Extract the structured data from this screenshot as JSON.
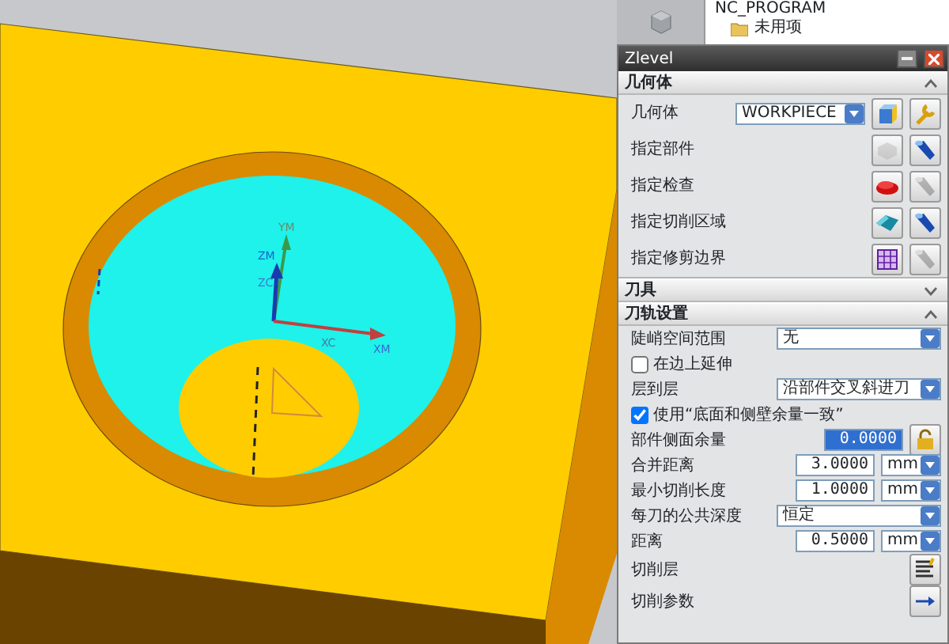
{
  "viewport": {
    "axis_labels": [
      "YM",
      "ZM",
      "ZC",
      "XC",
      "XM"
    ]
  },
  "navigator": {
    "items": [
      {
        "label": "NC_PROGRAM"
      },
      {
        "label": "未用项"
      }
    ]
  },
  "dialog": {
    "title": "Zlevel",
    "sections": [
      {
        "title": "几何体",
        "expanded": true,
        "rows": [
          {
            "kind": "select",
            "label": "几何体",
            "value": "WORKPIECE",
            "buttons": [
              {
                "kind": "new",
                "disabled": false
              },
              {
                "kind": "edit",
                "disabled": false
              }
            ]
          },
          {
            "kind": "specify",
            "label": "指定部件",
            "buttons": [
              {
                "kind": "part",
                "disabled": true
              },
              {
                "kind": "display",
                "disabled": false
              }
            ]
          },
          {
            "kind": "specify",
            "label": "指定检查",
            "buttons": [
              {
                "kind": "check",
                "disabled": false
              },
              {
                "kind": "display",
                "disabled": true
              }
            ]
          },
          {
            "kind": "specify",
            "label": "指定切削区域",
            "buttons": [
              {
                "kind": "area",
                "disabled": false
              },
              {
                "kind": "display",
                "disabled": false
              }
            ]
          },
          {
            "kind": "specify",
            "label": "指定修剪边界",
            "buttons": [
              {
                "kind": "trim",
                "disabled": false
              },
              {
                "kind": "display",
                "disabled": true
              }
            ]
          }
        ]
      },
      {
        "title": "刀具",
        "expanded": false
      },
      {
        "title": "刀轨设置",
        "expanded": true,
        "rows": [
          {
            "kind": "select",
            "label": "陡峭空间范围",
            "value": "无"
          },
          {
            "kind": "checkbox",
            "label": "在边上延伸",
            "checked": false
          },
          {
            "kind": "select",
            "label": "层到层",
            "value": "沿部件交叉斜进刀"
          },
          {
            "kind": "checkbox",
            "label": "使用“底面和侧壁余量一致”",
            "checked": true
          },
          {
            "kind": "number",
            "label": "部件侧面余量",
            "value": "0.0000",
            "selected": true,
            "buttons": [
              {
                "kind": "lock",
                "disabled": false
              }
            ]
          },
          {
            "kind": "number",
            "label": "合并距离",
            "value": "3.0000",
            "unit": "mm",
            "selected": false
          },
          {
            "kind": "number",
            "label": "最小切削长度",
            "value": "1.0000",
            "unit": "mm",
            "selected": false
          },
          {
            "kind": "select",
            "label": "每刀的公共深度",
            "value": "恒定"
          },
          {
            "kind": "number",
            "label": "距离",
            "value": "0.5000",
            "unit": "mm",
            "selected": false
          },
          {
            "kind": "action",
            "label": "切削层",
            "buttons": [
              {
                "kind": "levels",
                "disabled": false
              }
            ]
          },
          {
            "kind": "action",
            "label": "切削参数",
            "buttons": [
              {
                "kind": "params",
                "disabled": false
              }
            ]
          }
        ]
      }
    ]
  }
}
